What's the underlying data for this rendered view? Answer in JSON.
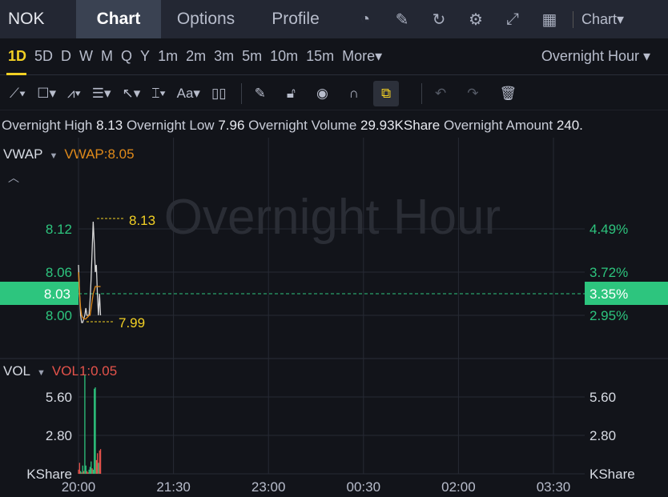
{
  "header": {
    "symbol": "NOK",
    "tabs": [
      "Chart",
      "Options",
      "Profile"
    ],
    "active_tab": "Chart",
    "icons": [
      "gauge-icon",
      "edit-icon",
      "refresh-icon",
      "gear-icon",
      "fullscreen-icon",
      "grid-layout-icon"
    ],
    "chart_type": "Chart▾"
  },
  "periods": {
    "items": [
      "1D",
      "5D",
      "D",
      "W",
      "M",
      "Q",
      "Y",
      "1m",
      "2m",
      "3m",
      "5m",
      "10m",
      "15m",
      "More▾"
    ],
    "active": "1D",
    "session": "Overnight Hour ▾"
  },
  "toolbar": {
    "tools": [
      "line-tool",
      "rectangle-tool",
      "pattern-tool",
      "fibonacci-tool",
      "arrow-tool",
      "measure-tool",
      "text-tool",
      "candle-tool",
      "pencil-tool",
      "lock-tool",
      "eye-tool",
      "magnet-tool",
      "link-tool",
      "undo",
      "redo",
      "delete"
    ]
  },
  "info": {
    "high_label": "Overnight High",
    "high": "8.13",
    "low_label": "Overnight Low",
    "low": "7.96",
    "volume_label": "Overnight Volume",
    "volume": "29.93KShare",
    "amount_label": "Overnight Amount",
    "amount": "240."
  },
  "price_panel": {
    "indicator": "VWAP",
    "vwap_value": "VWAP:8.05",
    "watermark": "Overnight Hour",
    "left_ticks": [
      "8.12",
      "8.06",
      "8.00"
    ],
    "right_ticks": [
      "4.49%",
      "3.72%",
      "2.95%"
    ],
    "current_price": "8.03",
    "current_pct": "3.35%",
    "high_marker": "8.13",
    "low_marker": "7.99"
  },
  "volume_panel": {
    "indicator": "VOL",
    "vol_value": "VOL1:0.05",
    "ticks": [
      "5.60",
      "2.80"
    ],
    "unit": "KShare"
  },
  "x_ticks": [
    "20:00",
    "21:30",
    "23:00",
    "00:30",
    "02:00",
    "03:30"
  ],
  "chart_data": {
    "type": "line",
    "price_minutes": [
      0,
      1,
      2,
      3,
      4,
      5,
      6,
      7,
      8,
      9,
      10,
      11,
      12,
      13,
      14,
      15,
      16,
      17,
      18,
      19,
      20,
      21
    ],
    "price": [
      8.07,
      8.03,
      8.0,
      7.99,
      7.99,
      7.995,
      8.0,
      8.01,
      8.0,
      8.0,
      8.0,
      8.02,
      8.05,
      8.09,
      8.13,
      8.1,
      8.06,
      8.07,
      8.03,
      8.0,
      8.03,
      8.0
    ],
    "vwap": [
      8.06,
      8.03,
      8.01,
      8.0,
      7.997,
      7.995,
      7.995,
      7.995,
      7.997,
      7.998,
      8.0,
      8.0,
      8.01,
      8.02,
      8.03,
      8.035,
      8.04,
      8.04,
      8.04,
      8.04,
      8.04,
      8.04
    ],
    "volume": [
      0.3,
      0.8,
      0.2,
      0.1,
      0.6,
      0.2,
      7.2,
      0.6,
      0.2,
      0.1,
      0.3,
      0.5,
      0.9,
      0.4,
      0.3,
      6.2,
      6.3,
      1.0,
      1.5,
      0.8,
      1.7,
      1.8
    ],
    "volume_up": [
      false,
      false,
      true,
      false,
      true,
      false,
      true,
      true,
      false,
      false,
      true,
      true,
      true,
      false,
      true,
      true,
      true,
      false,
      false,
      true,
      false,
      false
    ],
    "price_range": [
      7.96,
      8.18
    ],
    "volume_range": [
      0,
      8.4
    ]
  },
  "colors": {
    "up": "#2dc57e",
    "down": "#e5534b",
    "accent": "#f2d024",
    "vwap": "#e08a1a"
  }
}
